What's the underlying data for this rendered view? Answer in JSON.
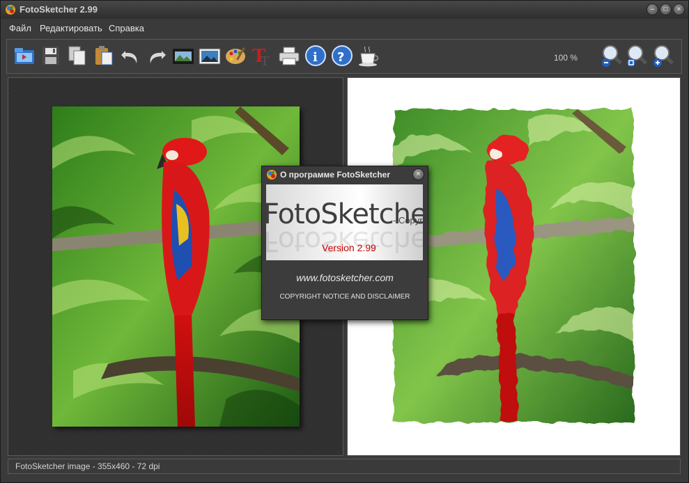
{
  "window": {
    "title": "FotoSketcher 2.99"
  },
  "menu": {
    "items": [
      "Файл",
      "Редактировать",
      "Справка"
    ]
  },
  "toolbar": {
    "icons": [
      "open-folder-icon",
      "save-disk-icon",
      "copy-icon",
      "paste-icon",
      "undo-icon",
      "redo-icon",
      "image-strip-icon",
      "picture-icon",
      "palette-icon",
      "text-icon",
      "printer-icon",
      "info-icon",
      "help-icon",
      "coffee-cup-icon",
      "zoom-out-icon",
      "zoom-fit-icon",
      "zoom-in-icon"
    ],
    "zoom": "100 %"
  },
  "status": {
    "text": "FotoSketcher image - 355x460 - 72 dpi"
  },
  "dialog": {
    "title": "О программе FotoSketcher",
    "logo": "FotoSketcher",
    "copy_fragment": "- Copyr",
    "version": "Version 2.99",
    "website": "www.fotosketcher.com",
    "copyright": "COPYRIGHT NOTICE AND DISCLAIMER"
  },
  "colors": {
    "accent_red": "#cc0000",
    "background": "#3a3a3a"
  }
}
